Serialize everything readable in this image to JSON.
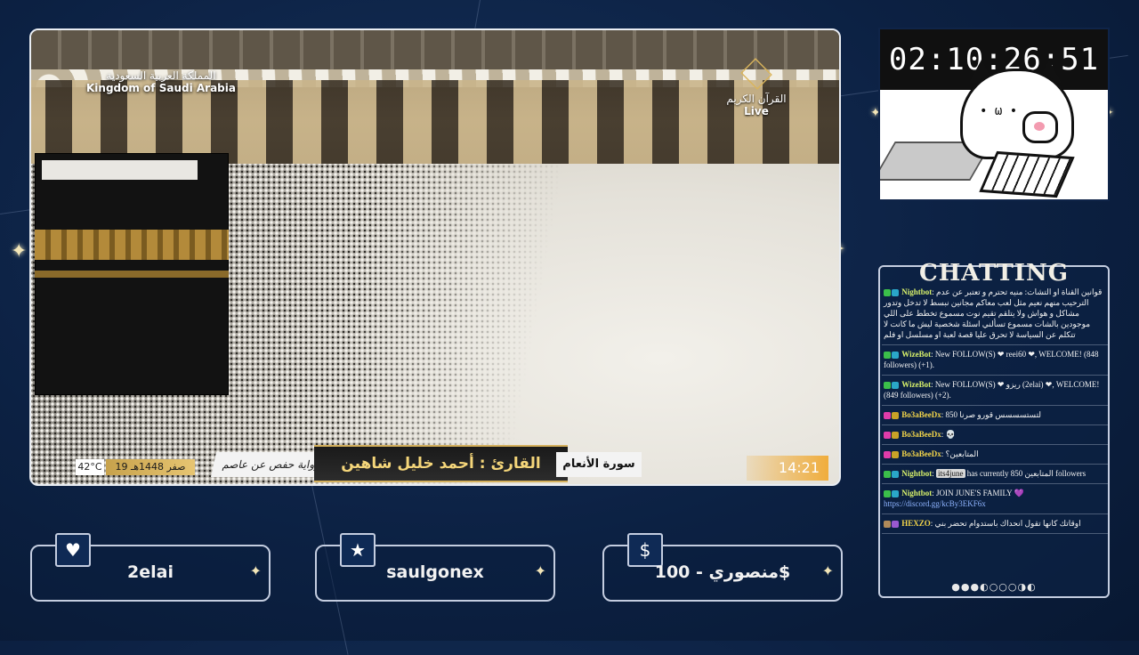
{
  "timer": {
    "value": "02:10:26:51"
  },
  "video": {
    "ksa_ar": "المملكة العربية السعودية",
    "ksa_en": "Kingdom of Saudi Arabia",
    "channel_name": "القرآن الكريم",
    "live_label": "Live",
    "temperature": "42°C",
    "hijri_date": "19 صفر 1448هـ",
    "riwaya": "رواية حفص عن عاصم",
    "qari": "القارئ : أحمد خليل شاهين",
    "surah": "سورة الأنعام",
    "clock": "14:21"
  },
  "chat": {
    "title": "CHATTING",
    "messages": [
      {
        "user": "Nightbot",
        "text": "قوانين القناة او التشات: منيه تحترم و تعتبر عن عدم الترحيب منهم نعيم مثل لعب معاكم مجانين نبسط لا تدخل وتدور مشاكل و هواش ولا يتلقم تقيم نوت مسموع تخطط على اللي موجودين بالشات مسموع تسألني اسئلة شخصية ليش ما كانت لا تتكلم عن السياسة لا تحرق عليا قصة لعبة او مسلسل او فلم"
      },
      {
        "user": "WizeBot",
        "text": "New FOLLOW(S) ❤ reei60 ❤, WELCOME! (848 followers) (+1)."
      },
      {
        "user": "WizeBot",
        "text": "New FOLLOW(S) ❤ ريزو (2elai) ❤, WELCOME! (849 followers) (+2)."
      },
      {
        "user": "Bo3aBeeDx",
        "text": "لتستسسسس قورو صرنا 850"
      },
      {
        "user": "Bo3aBeeDx",
        "text": "💀"
      },
      {
        "user": "Bo3aBeeDx",
        "text": "المتابعين؟"
      },
      {
        "user": "Nightbot",
        "mention": "its4june",
        "text": "has currently 850 المتابعين followers"
      },
      {
        "user": "Nightbot",
        "text": "JOIN JUNE'S FAMILY 💜",
        "link": "https://discord.gg/kcBy3EKF6x"
      },
      {
        "user": "HEXZO",
        "text": "اوقاتك كانها تقول انحداك باستدوام تحضر بني"
      }
    ],
    "moon_phases": "●●●◐○○○◑◐"
  },
  "cards": [
    {
      "icon": "♥",
      "value": "2elai"
    },
    {
      "icon": "★",
      "value": "saulgonex"
    },
    {
      "icon": "$",
      "value": "منصوري - 100$"
    }
  ]
}
